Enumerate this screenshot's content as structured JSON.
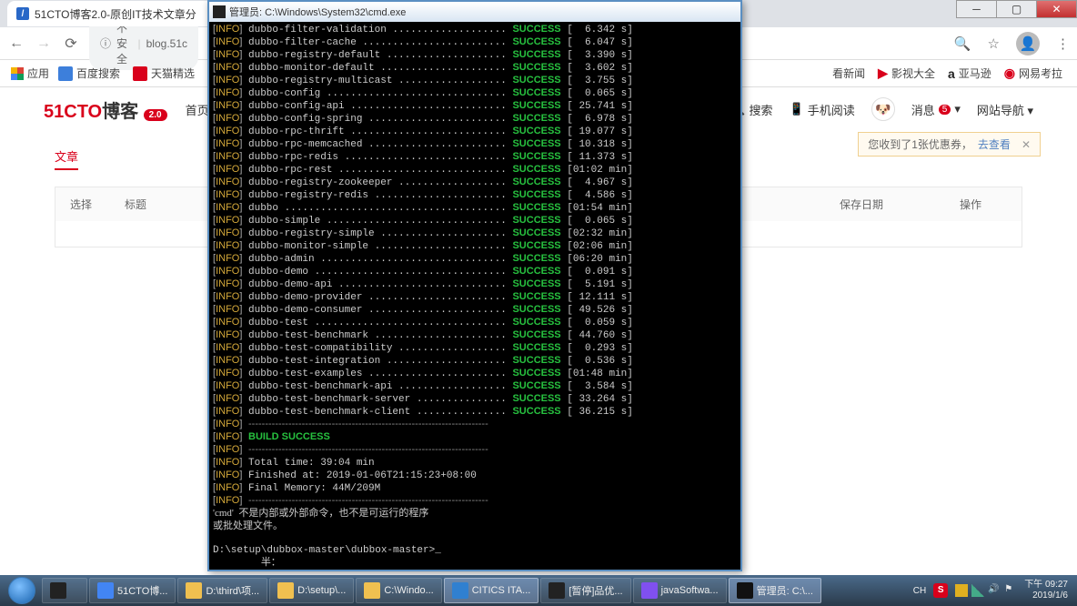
{
  "chrome": {
    "tab_title": "51CTO博客2.0-原创IT技术文章分",
    "url_prefix": "不安全",
    "url": "blog.51c",
    "bookmarks_label": "应用",
    "bookmarks": [
      {
        "label": "百度搜索",
        "color": "#3d7fdb"
      },
      {
        "label": "天猫精选",
        "color": "#d9001b"
      }
    ],
    "bookmarks_right": [
      {
        "label": "看新闻",
        "color": "#666"
      },
      {
        "label": "影视大全",
        "color": "#d9001b",
        "icon": "▶"
      },
      {
        "label": "亚马逊",
        "color": "#222",
        "icon": "a"
      },
      {
        "label": "网易考拉",
        "color": "#d9001b",
        "icon": "◉"
      }
    ]
  },
  "page": {
    "logo_a": "51CTO",
    "logo_b": "博客",
    "logo_badge": "2.0",
    "menu": [
      "首页"
    ],
    "search_label": "搜索",
    "phone_label": "手机阅读",
    "msg_label": "消息",
    "msg_count": "5",
    "nav_label": "网站导航",
    "yellow_msg": "您收到了1张优惠券，",
    "yellow_link": "去查看",
    "article_tab": "文章",
    "th_select": "选择",
    "th_title": "标题",
    "th_date": "保存日期",
    "th_op": "操作"
  },
  "cmd": {
    "title": "管理员: C:\\Windows\\System32\\cmd.exe",
    "level": "INFO",
    "rows": [
      {
        "name": "dubbo-filter-validation",
        "time": "6.342 s"
      },
      {
        "name": "dubbo-filter-cache",
        "time": "6.047 s"
      },
      {
        "name": "dubbo-registry-default",
        "time": "3.390 s"
      },
      {
        "name": "dubbo-monitor-default",
        "time": "3.602 s"
      },
      {
        "name": "dubbo-registry-multicast",
        "time": "3.755 s"
      },
      {
        "name": "dubbo-config",
        "time": "0.065 s"
      },
      {
        "name": "dubbo-config-api",
        "time": "25.741 s"
      },
      {
        "name": "dubbo-config-spring",
        "time": "6.978 s"
      },
      {
        "name": "dubbo-rpc-thrift",
        "time": "19.077 s"
      },
      {
        "name": "dubbo-rpc-memcached",
        "time": "10.318 s"
      },
      {
        "name": "dubbo-rpc-redis",
        "time": "11.373 s"
      },
      {
        "name": "dubbo-rpc-rest",
        "time": "01:02 min"
      },
      {
        "name": "dubbo-registry-zookeeper",
        "time": "4.967 s"
      },
      {
        "name": "dubbo-registry-redis",
        "time": "4.586 s"
      },
      {
        "name": "dubbo",
        "time": "01:54 min"
      },
      {
        "name": "dubbo-simple",
        "time": "0.065 s"
      },
      {
        "name": "dubbo-registry-simple",
        "time": "02:32 min"
      },
      {
        "name": "dubbo-monitor-simple",
        "time": "02:06 min"
      },
      {
        "name": "dubbo-admin",
        "time": "06:20 min"
      },
      {
        "name": "dubbo-demo",
        "time": "0.091 s"
      },
      {
        "name": "dubbo-demo-api",
        "time": "5.191 s"
      },
      {
        "name": "dubbo-demo-provider",
        "time": "12.111 s"
      },
      {
        "name": "dubbo-demo-consumer",
        "time": "49.526 s"
      },
      {
        "name": "dubbo-test",
        "time": "0.059 s"
      },
      {
        "name": "dubbo-test-benchmark",
        "time": "44.760 s"
      },
      {
        "name": "dubbo-test-compatibility",
        "time": "0.293 s"
      },
      {
        "name": "dubbo-test-integration",
        "time": "0.536 s"
      },
      {
        "name": "dubbo-test-examples",
        "time": "01:48 min"
      },
      {
        "name": "dubbo-test-benchmark-api",
        "time": "3.584 s"
      },
      {
        "name": "dubbo-test-benchmark-server",
        "time": "33.264 s"
      },
      {
        "name": "dubbo-test-benchmark-client",
        "time": "36.215 s"
      }
    ],
    "status": "SUCCESS",
    "build_success": "BUILD SUCCESS",
    "total_time": "Total time: 39:04 min",
    "finished_at": "Finished at: 2019-01-06T21:15:23+08:00",
    "final_memory": "Final Memory: 44M/209M",
    "err_line": "'cmd'  不是内部或外部命令，也不是可运行的程序",
    "err_line2": "或批处理文件。",
    "prompt": "D:\\setup\\dubbox-master\\dubbox-master>_",
    "half": "半："
  },
  "taskbar": {
    "items": [
      {
        "label": "",
        "color": "#222"
      },
      {
        "label": "51CTO博...",
        "color": "#4285f4"
      },
      {
        "label": "D:\\third\\项...",
        "color": "#f0c050"
      },
      {
        "label": "D:\\setup\\...",
        "color": "#f0c050"
      },
      {
        "label": "C:\\Windo...",
        "color": "#f0c050"
      },
      {
        "label": "CITICS ITA...",
        "color": "#3080d0",
        "active": true
      },
      {
        "label": "[暂停]品优...",
        "color": "#222"
      },
      {
        "label": "javaSoftwa...",
        "color": "#8050f0"
      },
      {
        "label": "管理员: C:\\...",
        "color": "#111",
        "active": true
      }
    ],
    "ime": "CH",
    "sogou": "S",
    "time": "下午 09:27",
    "date": "2019/1/6"
  }
}
